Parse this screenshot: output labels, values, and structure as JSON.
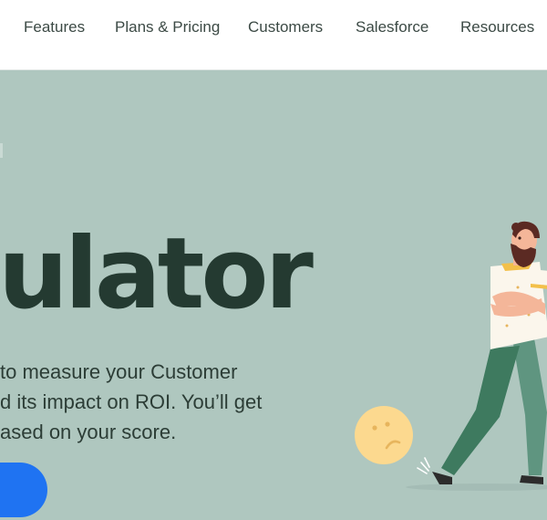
{
  "nav": {
    "items": [
      {
        "label": "Features"
      },
      {
        "label": "Plans & Pricing"
      },
      {
        "label": "Customers"
      },
      {
        "label": "Salesforce"
      },
      {
        "label": "Resources"
      }
    ]
  },
  "hero": {
    "title": "ulator",
    "description_lines": [
      "to measure your Customer",
      "d its impact on ROI. You’ll get",
      "ased on your score."
    ],
    "cta_label": ""
  },
  "colors": {
    "hero_background": "#afc7bf",
    "title_color": "#243a31",
    "cta_blue": "#1f73f2",
    "face_yellow": "#fcd98f"
  },
  "icons": {
    "illustration": "man-kicking-sad-face-ball-illustration",
    "ball": "sad-face-icon"
  }
}
